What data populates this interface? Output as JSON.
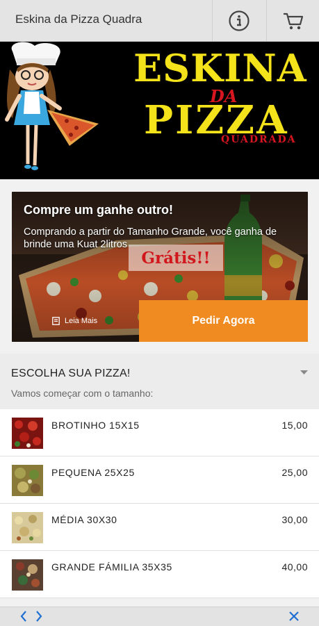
{
  "header": {
    "title": "Eskina da Pizza Quadra",
    "info_icon": "info-icon",
    "cart_icon": "cart-icon"
  },
  "banner": {
    "logo_line1": "ESKINA",
    "logo_line2": "DA",
    "logo_line3": "PIZZA",
    "logo_line4": "QUADRADA",
    "colors": {
      "yellow": "#f4e21a",
      "red": "#d7161f",
      "background": "#000000"
    }
  },
  "promo": {
    "title": "Compre um ganhe outro!",
    "description": "Comprando a partir do Tamanho Grande, você ganha de brinde uma Kuat 2litros",
    "badge": "Grátis!!",
    "read_more_label": "Leia Mais",
    "order_button_label": "Pedir Agora",
    "accent": "#f08b21"
  },
  "menu_section": {
    "title": "ESCOLHA SUA PIZZA!",
    "subtitle": "Vamos começar com o tamanho:",
    "collapse_icon": "caret-down-icon"
  },
  "sizes": [
    {
      "name": "BROTINHO 15X15",
      "price": "15,00"
    },
    {
      "name": "PEQUENA 25X25",
      "price": "25,00"
    },
    {
      "name": "MÉDIA 30X30",
      "price": "30,00"
    },
    {
      "name": "GRANDE FÁMILIA 35X35",
      "price": "40,00"
    }
  ],
  "bottom_bar": {
    "back_icon": "chevron-left-icon",
    "forward_icon": "chevron-right-icon",
    "close_icon": "close-icon"
  }
}
